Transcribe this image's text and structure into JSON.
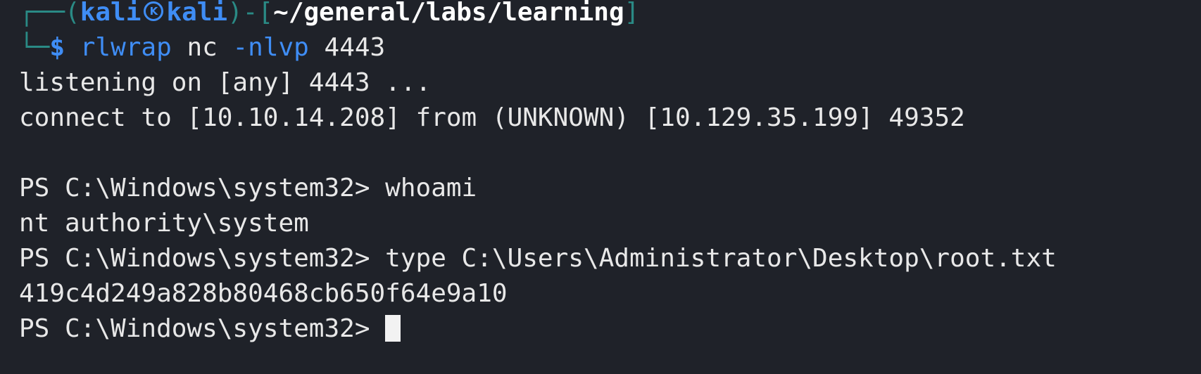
{
  "terminal": {
    "prompt": {
      "frame_top": "┌──(",
      "user": "kali",
      "host": "kali",
      "frame_mid": ")-[",
      "path": "~/general/labs/learning",
      "frame_end": "]",
      "frame_bottom": "└─",
      "dollar": "$",
      "command_name": "rlwrap",
      "command_mid": " nc ",
      "command_flag": "-nlvp",
      "command_arg": " 4443"
    },
    "output": {
      "listening": "listening on [any] 4443 ...",
      "connect": "connect to [10.10.14.208] from (UNKNOWN) [10.129.35.199] 49352",
      "ps_prompt_1": "PS C:\\Windows\\system32> ",
      "cmd_1": "whoami",
      "result_1": "nt authority\\system",
      "ps_prompt_2": "PS C:\\Windows\\system32> ",
      "cmd_2": "type C:\\Users\\Administrator\\Desktop\\root.txt",
      "result_2": "419c4d249a828b80468cb650f64e9a10",
      "ps_prompt_3": "PS C:\\Windows\\system32> "
    },
    "icons": {
      "kali_logo": "kali-logo-icon",
      "cursor": "block-cursor"
    },
    "colors": {
      "background": "#1f2229",
      "text": "#e8e8e8",
      "accent_blue": "#3f8df5",
      "frame_teal": "#2a8a85",
      "path_white": "#ffffff"
    }
  }
}
